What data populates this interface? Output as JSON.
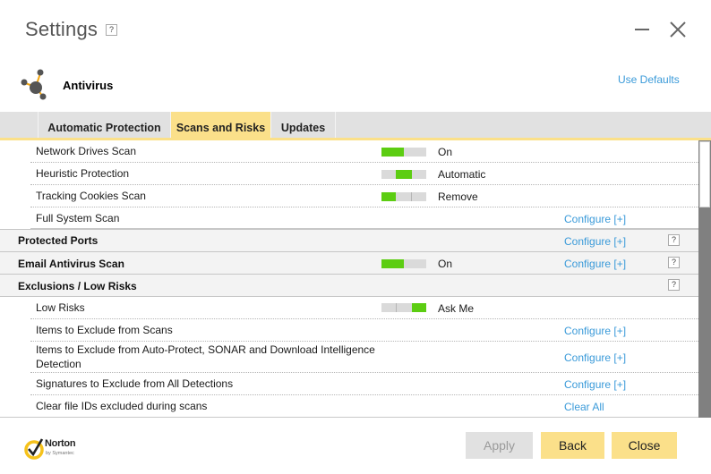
{
  "window": {
    "title": "Settings",
    "help_label": "?",
    "minimize_icon": "minimize-icon",
    "close_icon": "close-icon"
  },
  "section": {
    "icon": "antivirus-molecule-icon",
    "title": "Antivirus",
    "use_defaults": "Use Defaults"
  },
  "tabs": [
    {
      "label": "Automatic Protection",
      "active": false
    },
    {
      "label": "Scans and Risks",
      "active": true
    },
    {
      "label": "Updates",
      "active": false
    }
  ],
  "rows": [
    {
      "type": "sub",
      "label": "Network Drives Scan",
      "toggle": {
        "positions": 2,
        "selected": 0,
        "value": "on"
      },
      "state": "On"
    },
    {
      "type": "sub",
      "label": "Heuristic Protection",
      "toggle": {
        "positions": 3,
        "selected": 1,
        "value": "automatic"
      },
      "state": "Automatic"
    },
    {
      "type": "sub",
      "label": "Tracking Cookies Scan",
      "toggle": {
        "positions": 3,
        "selected": 0,
        "value": "remove"
      },
      "state": "Remove"
    },
    {
      "type": "sub",
      "label": "Full System Scan",
      "link": "Configure [+]"
    },
    {
      "type": "header",
      "label": "Protected Ports",
      "link": "Configure [+]",
      "help": "?"
    },
    {
      "type": "header",
      "label": "Email Antivirus Scan",
      "toggle": {
        "positions": 2,
        "selected": 0,
        "value": "on"
      },
      "state": "On",
      "link": "Configure [+]",
      "help": "?"
    },
    {
      "type": "header",
      "label": "Exclusions / Low Risks",
      "help": "?"
    },
    {
      "type": "sub",
      "label": "Low Risks",
      "toggle": {
        "positions": 3,
        "selected": 2,
        "value": "ask-me"
      },
      "state": "Ask Me"
    },
    {
      "type": "sub",
      "label": "Items to Exclude from Scans",
      "link": "Configure [+]"
    },
    {
      "type": "sub",
      "label": "Items to Exclude from Auto-Protect, SONAR and Download Intelligence Detection",
      "link": "Configure [+]"
    },
    {
      "type": "sub",
      "label": "Signatures to Exclude from All Detections",
      "link": "Configure [+]"
    },
    {
      "type": "sub",
      "label": "Clear file IDs excluded during scans",
      "link": "Clear All"
    }
  ],
  "colors": {
    "accent_yellow": "#fbe08a",
    "toggle_on": "#5ccd12",
    "link_blue": "#3a9ad9"
  },
  "footer": {
    "brand": "Norton",
    "brand_sub": "by Symantec",
    "buttons": {
      "apply": "Apply",
      "back": "Back",
      "close": "Close"
    }
  }
}
